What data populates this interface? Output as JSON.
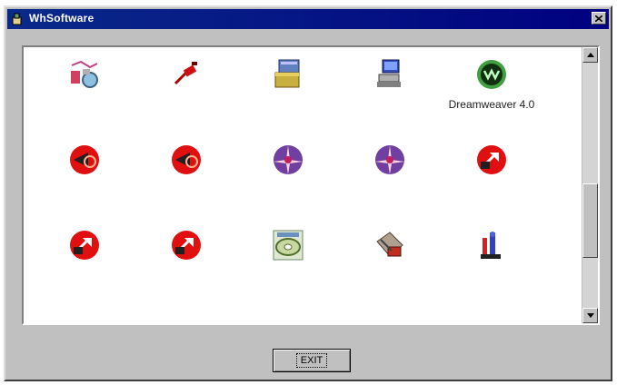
{
  "window": {
    "title": "WhSoftware",
    "close_icon": "close-icon"
  },
  "items": [
    {
      "icon": "network-icon",
      "label": ""
    },
    {
      "icon": "cable-plug-icon",
      "label": ""
    },
    {
      "icon": "installer-box-icon",
      "label": ""
    },
    {
      "icon": "computer-setup-icon",
      "label": ""
    },
    {
      "icon": "dreamweaver-icon",
      "label": "Dreamweaver 4.0"
    },
    {
      "icon": "red-circle-icon",
      "label": ""
    },
    {
      "icon": "red-circle-icon",
      "label": ""
    },
    {
      "icon": "purple-swirl-icon",
      "label": ""
    },
    {
      "icon": "purple-swirl-icon",
      "label": ""
    },
    {
      "icon": "red-arrow-icon",
      "label": ""
    },
    {
      "icon": "red-arrow-icon",
      "label": ""
    },
    {
      "icon": "red-arrow-icon",
      "label": ""
    },
    {
      "icon": "cd-disc-icon",
      "label": ""
    },
    {
      "icon": "card-tool-icon",
      "label": ""
    },
    {
      "icon": "flask-icon",
      "label": ""
    }
  ],
  "exit_label": "EXIT",
  "colors": {
    "titlebar": "#000080",
    "face": "#c0c0c0"
  }
}
